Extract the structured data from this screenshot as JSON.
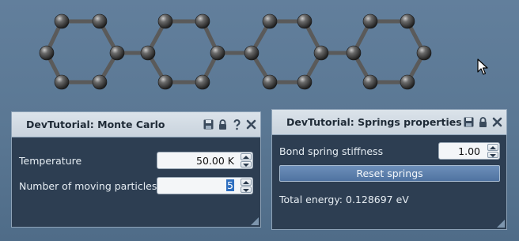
{
  "scene": {
    "description_label": "",
    "atom_color": "#3b3b3b",
    "bond_color": "#5a5a5a"
  },
  "monte_carlo_panel": {
    "title": "DevTutorial: Monte Carlo",
    "temperature_label": "Temperature",
    "temperature_value": "50.00 K",
    "particles_label": "Number of moving particles",
    "particles_value": "5",
    "icons": [
      "save-icon",
      "lock-icon",
      "help-icon",
      "close-icon"
    ]
  },
  "springs_panel": {
    "title": "DevTutorial: Springs properties",
    "stiffness_label": "Bond spring stiffness",
    "stiffness_value": "1.00",
    "reset_label": "Reset springs",
    "energy_text": "Total energy: 0.128697 eV",
    "icons": [
      "save-icon",
      "lock-icon",
      "close-icon"
    ]
  },
  "colors": {
    "panel_bg": "#2d3e52",
    "header_bg": "#d3dce5",
    "accent": "#4f73a1"
  }
}
